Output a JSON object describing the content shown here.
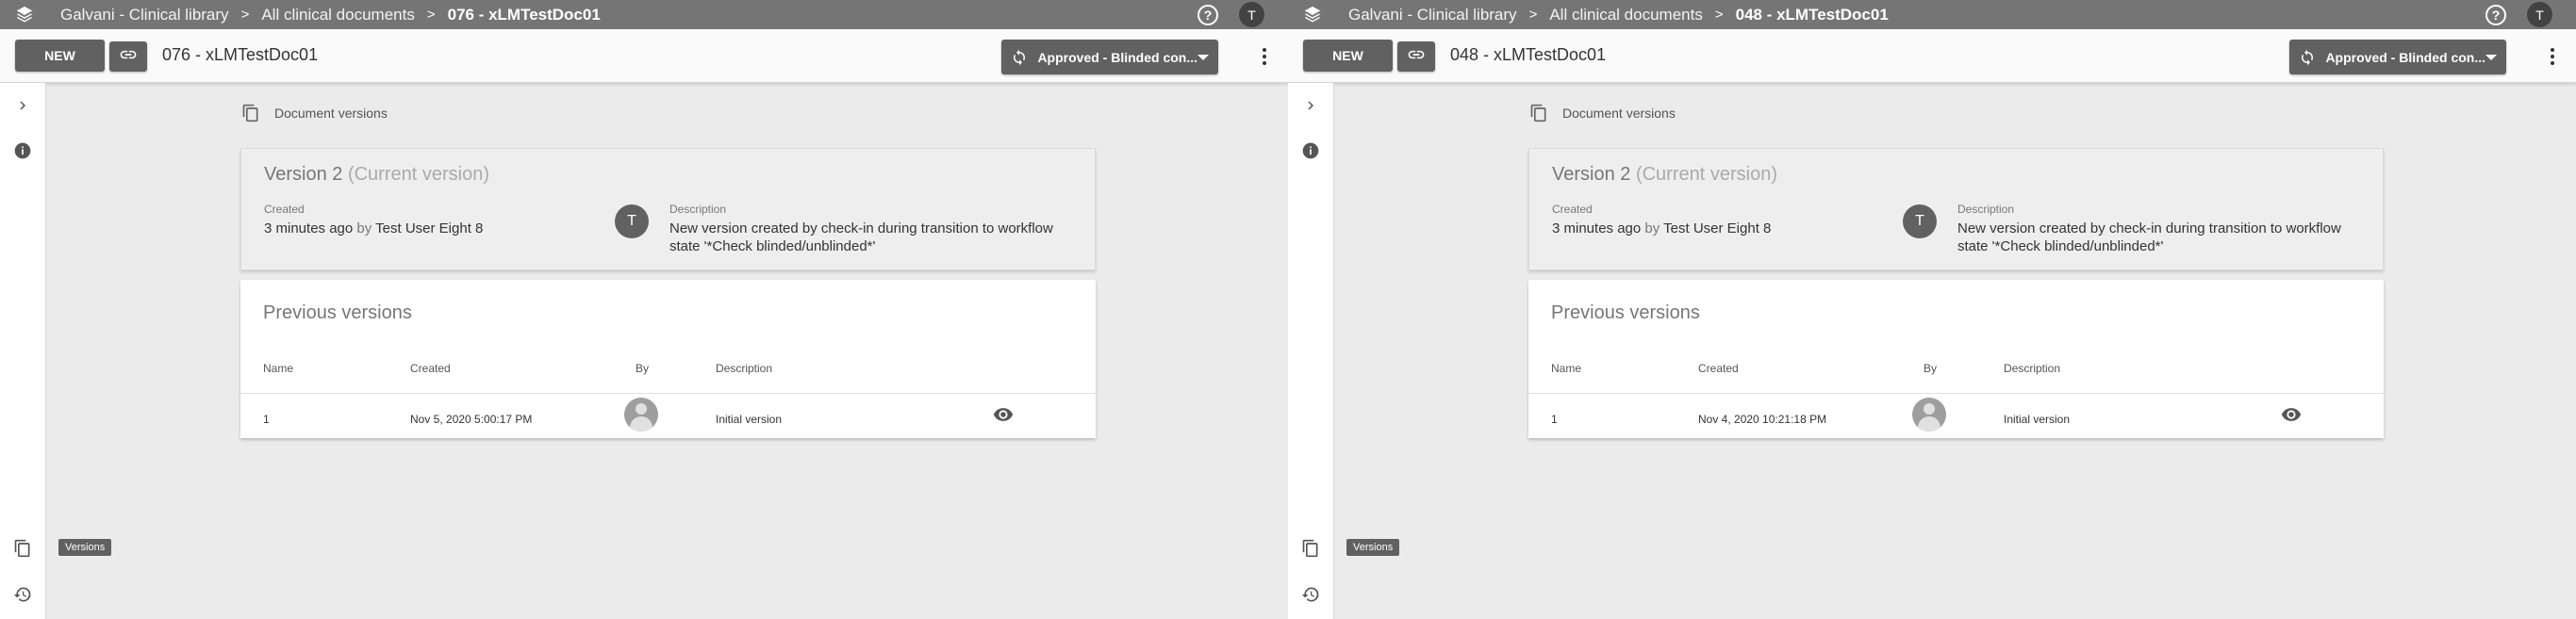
{
  "panes": [
    {
      "breadcrumb": [
        "Galvani - Clinical library",
        "All clinical documents",
        "076 - xLMTestDoc01"
      ],
      "user_initial": "T",
      "toolbar": {
        "new_label": "NEW",
        "doc_title": "076 - xLMTestDoc01",
        "status_label": "Approved - Blinded con..."
      },
      "section_title": "Document versions",
      "current": {
        "version": "Version 2",
        "tag": "(Current version)",
        "created_label": "Created",
        "created_time": "3 minutes ago",
        "by_word": "by",
        "created_by": "Test User Eight 8",
        "avatar_initial": "T",
        "description_label": "Description",
        "description": "New version created by check-in during transition to workflow state '*Check blinded/unblinded*'"
      },
      "previous": {
        "title": "Previous versions",
        "columns": [
          "Name",
          "Created",
          "By",
          "Description"
        ],
        "rows": [
          {
            "name": "1",
            "created": "Nov 5, 2020 5:00:17 PM",
            "description": "Initial version"
          }
        ]
      },
      "tooltip": "Versions"
    },
    {
      "breadcrumb": [
        "Galvani - Clinical library",
        "All clinical documents",
        "048 - xLMTestDoc01"
      ],
      "user_initial": "T",
      "toolbar": {
        "new_label": "NEW",
        "doc_title": "048 - xLMTestDoc01",
        "status_label": "Approved - Blinded con..."
      },
      "section_title": "Document versions",
      "current": {
        "version": "Version 2",
        "tag": "(Current version)",
        "created_label": "Created",
        "created_time": "3 minutes ago",
        "by_word": "by",
        "created_by": "Test User Eight 8",
        "avatar_initial": "T",
        "description_label": "Description",
        "description": "New version created by check-in during transition to workflow state '*Check blinded/unblinded*'"
      },
      "previous": {
        "title": "Previous versions",
        "columns": [
          "Name",
          "Created",
          "By",
          "Description"
        ],
        "rows": [
          {
            "name": "1",
            "created": "Nov 4, 2020 10:21:18 PM",
            "description": "Initial version"
          }
        ]
      },
      "tooltip": "Versions"
    }
  ],
  "icons": {
    "logo": "layers-icon",
    "help": "help-circle-icon",
    "link": "link-icon",
    "status": "sync-icon",
    "status_caret": "caret-down-icon",
    "more": "more-vert-icon",
    "expand": "chevron-right-icon",
    "info": "info-icon",
    "versions": "copy-icon",
    "history": "history-icon",
    "view": "eye-icon"
  },
  "colors": {
    "top_bar": "#757575",
    "button": "#616161",
    "background": "#ebebeb",
    "card": "#ffffff"
  }
}
